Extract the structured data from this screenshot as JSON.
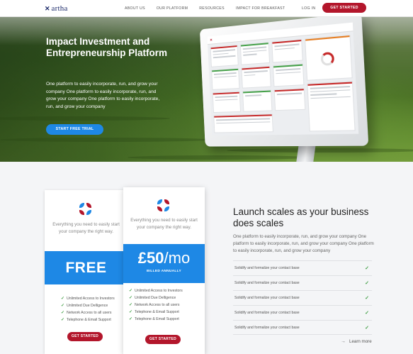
{
  "nav": {
    "brand": "artha",
    "links": [
      "ABOUT US",
      "OUR PLATFORM",
      "RESOURCES",
      "IMPACT FOR BREAKFAST"
    ],
    "login": "LOG IN",
    "cta": "GET STARTED"
  },
  "hero": {
    "title": "Impact Investment and Entrepreneurship Platform",
    "body": "One platform to easily incorporate, run, and grow your company One platform to easily incorporate, run, and grow your company One platform to easily incorporate, run, and grow your company",
    "cta": "START FREE TRIAL"
  },
  "pricing": {
    "free": {
      "description": "Everything you need to easily start your company the right way.",
      "price": "FREE",
      "features": [
        "Unlimited Access to Investors",
        "Unlimited Due Delligence",
        "Network Access to all users",
        "Telephone & Email Support"
      ],
      "cta": "GET STARTED"
    },
    "pro": {
      "description": "Everything you need to easily start your company the right way.",
      "price": "£50",
      "period": "/mo",
      "billing": "BILLED ANNUALLY",
      "features": [
        "Unlimited Access to Investors",
        "Unlimited Due Delligence",
        "Network Access to all users",
        "Telephone & Email Support",
        "Telephone & Email Support"
      ],
      "cta": "GET STARTED"
    }
  },
  "launch": {
    "title": "Launch scales as your business does scales",
    "body": "One platform to easily incorporate, run, and grow your company One platform to easily incorporate, run, and grow your company One platform to easily incorporate, run, and grow your company",
    "items": [
      "Solidify and formalize your contact base",
      "Solidify and formalize your contact base",
      "Solidify and formalize your contact base",
      "Solidify and formalize your contact base",
      "Solidify and formalize your contact base"
    ],
    "learn_more": "Learn more"
  },
  "colors": {
    "brand_red": "#b3162b",
    "accent_blue": "#1e88e5",
    "check_green": "#43a047",
    "navy": "#1d2b6b"
  },
  "icons": {
    "logo_mark": "x-mark-icon",
    "plan_icon": "flower-icon",
    "check": "check-icon",
    "arrow": "arrow-right-icon"
  }
}
